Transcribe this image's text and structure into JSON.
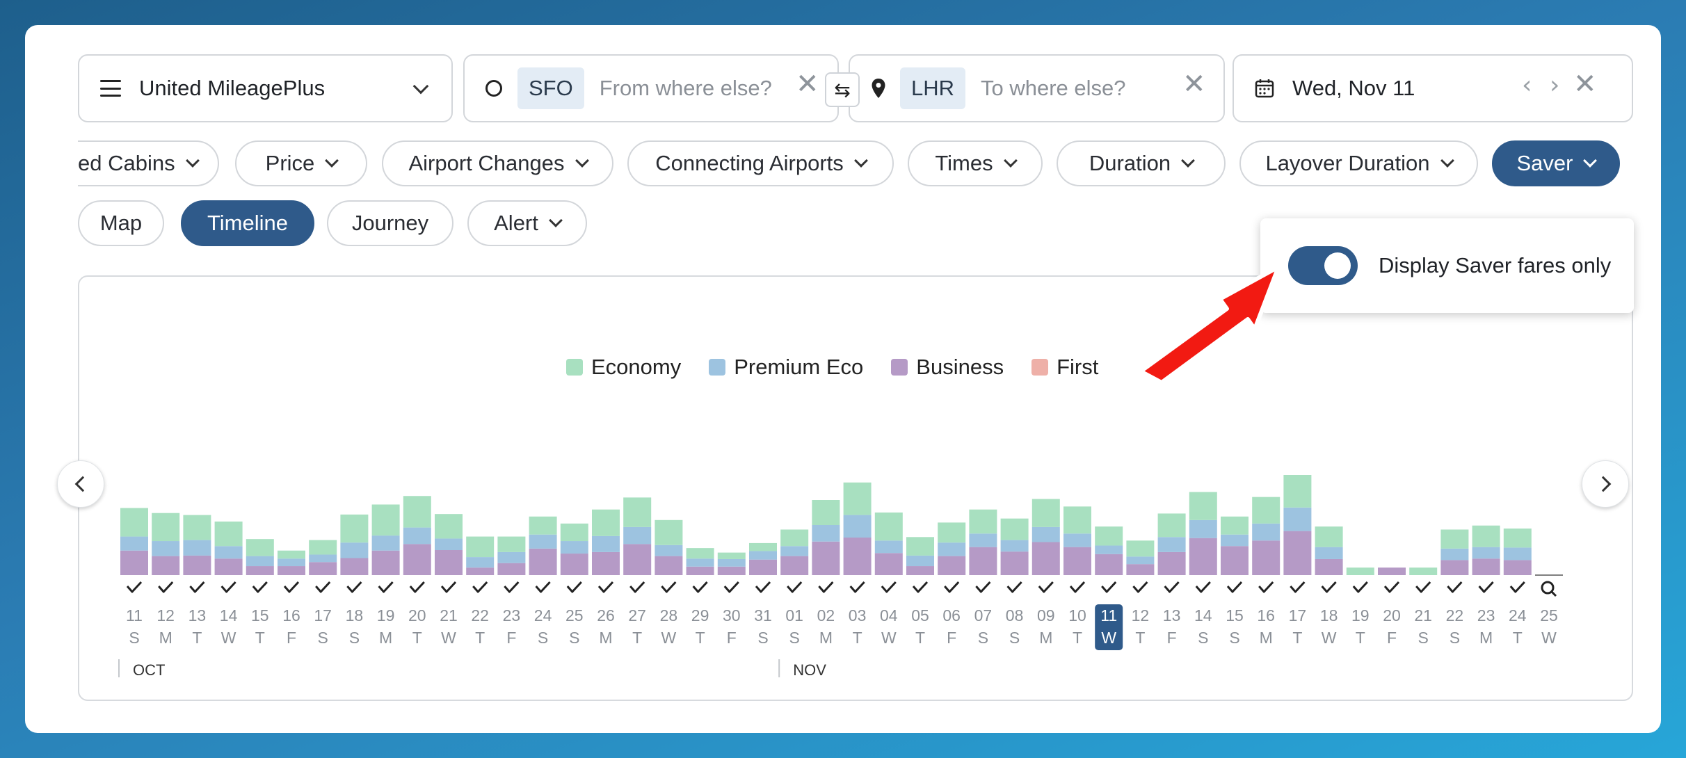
{
  "search": {
    "program": "United MileagePlus",
    "from_code": "SFO",
    "from_placeholder": "From where else?",
    "to_code": "LHR",
    "to_placeholder": "To where else?",
    "date": "Wed, Nov 11"
  },
  "filters": [
    {
      "label": "ted Cabins",
      "active": false
    },
    {
      "label": "Price",
      "active": false
    },
    {
      "label": "Airport Changes",
      "active": false
    },
    {
      "label": "Connecting Airports",
      "active": false
    },
    {
      "label": "Times",
      "active": false
    },
    {
      "label": "Duration",
      "active": false
    },
    {
      "label": "Layover Duration",
      "active": false
    },
    {
      "label": "Saver",
      "active": true
    }
  ],
  "views": [
    {
      "label": "Map",
      "active": false,
      "chevron": false
    },
    {
      "label": "Timeline",
      "active": true,
      "chevron": false
    },
    {
      "label": "Journey",
      "active": false,
      "chevron": false
    },
    {
      "label": "Alert",
      "active": false,
      "chevron": true
    }
  ],
  "saver_popover": {
    "label": "Display Saver fares only",
    "enabled": true
  },
  "colors": {
    "economy": "#a8e0c0",
    "premium": "#9dc3e0",
    "business": "#b59ac6",
    "first": "#eeb0a8",
    "accent": "#2f5a8a"
  },
  "chart_data": {
    "type": "bar",
    "stacked": true,
    "legend": [
      "Economy",
      "Premium Eco",
      "Business",
      "First"
    ],
    "days": [
      "11",
      "12",
      "13",
      "14",
      "15",
      "16",
      "17",
      "18",
      "19",
      "20",
      "21",
      "22",
      "23",
      "24",
      "25",
      "26",
      "27",
      "28",
      "29",
      "30",
      "31",
      "01",
      "02",
      "03",
      "04",
      "05",
      "06",
      "07",
      "08",
      "09",
      "10",
      "11",
      "12",
      "13",
      "14",
      "15",
      "16",
      "17",
      "18",
      "19",
      "20",
      "21",
      "22",
      "23",
      "24",
      "25"
    ],
    "weekdays": [
      "S",
      "M",
      "T",
      "W",
      "T",
      "F",
      "S",
      "S",
      "M",
      "T",
      "W",
      "T",
      "F",
      "S",
      "S",
      "M",
      "T",
      "W",
      "T",
      "F",
      "S",
      "S",
      "M",
      "T",
      "W",
      "T",
      "F",
      "S",
      "S",
      "M",
      "T",
      "W",
      "T",
      "F",
      "S",
      "S",
      "M",
      "T",
      "W",
      "T",
      "F",
      "S",
      "S",
      "M",
      "T",
      "W"
    ],
    "months": [
      {
        "label": "OCT",
        "start_index": 0
      },
      {
        "label": "NOV",
        "start_index": 21
      }
    ],
    "selected_index": 31,
    "marks": [
      "check",
      "check",
      "check",
      "check",
      "check",
      "check",
      "check",
      "check",
      "check",
      "check",
      "check",
      "check",
      "check",
      "check",
      "check",
      "check",
      "check",
      "check",
      "check",
      "check",
      "check",
      "check",
      "check",
      "check",
      "check",
      "check",
      "check",
      "check",
      "check",
      "check",
      "check",
      "check",
      "check",
      "check",
      "check",
      "check",
      "check",
      "check",
      "check",
      "check",
      "check",
      "check",
      "check",
      "check",
      "check",
      "search"
    ],
    "series": [
      {
        "name": "Business",
        "values": [
          49,
          38,
          39,
          33,
          18,
          18,
          26,
          34,
          49,
          62,
          50,
          15,
          24,
          53,
          43,
          46,
          62,
          38,
          17,
          17,
          31,
          38,
          67,
          75,
          44,
          18,
          38,
          56,
          47,
          66,
          56,
          42,
          22,
          46,
          74,
          58,
          69,
          88,
          32,
          0,
          15,
          0,
          30,
          33,
          30,
          0
        ]
      },
      {
        "name": "Premium Eco",
        "values": [
          28,
          30,
          31,
          25,
          20,
          15,
          15,
          31,
          30,
          33,
          23,
          21,
          22,
          28,
          25,
          32,
          34,
          22,
          16,
          15,
          17,
          20,
          33,
          45,
          25,
          21,
          27,
          27,
          23,
          30,
          27,
          17,
          15,
          30,
          36,
          23,
          34,
          47,
          24,
          0,
          0,
          0,
          23,
          23,
          25,
          0
        ]
      },
      {
        "name": "Economy",
        "values": [
          57,
          56,
          50,
          49,
          34,
          16,
          29,
          56,
          62,
          63,
          49,
          41,
          31,
          36,
          35,
          53,
          59,
          50,
          21,
          13,
          16,
          33,
          50,
          65,
          56,
          37,
          40,
          48,
          43,
          56,
          54,
          38,
          32,
          47,
          56,
          36,
          53,
          65,
          41,
          15,
          0,
          15,
          38,
          43,
          38,
          0
        ]
      },
      {
        "name": "First",
        "values": [
          0,
          0,
          0,
          0,
          0,
          0,
          0,
          0,
          0,
          0,
          0,
          0,
          0,
          0,
          0,
          0,
          0,
          0,
          0,
          0,
          0,
          0,
          0,
          0,
          0,
          0,
          0,
          0,
          0,
          0,
          0,
          0,
          0,
          0,
          0,
          0,
          0,
          0,
          0,
          0,
          0,
          0,
          0,
          0,
          0,
          0
        ]
      }
    ]
  }
}
